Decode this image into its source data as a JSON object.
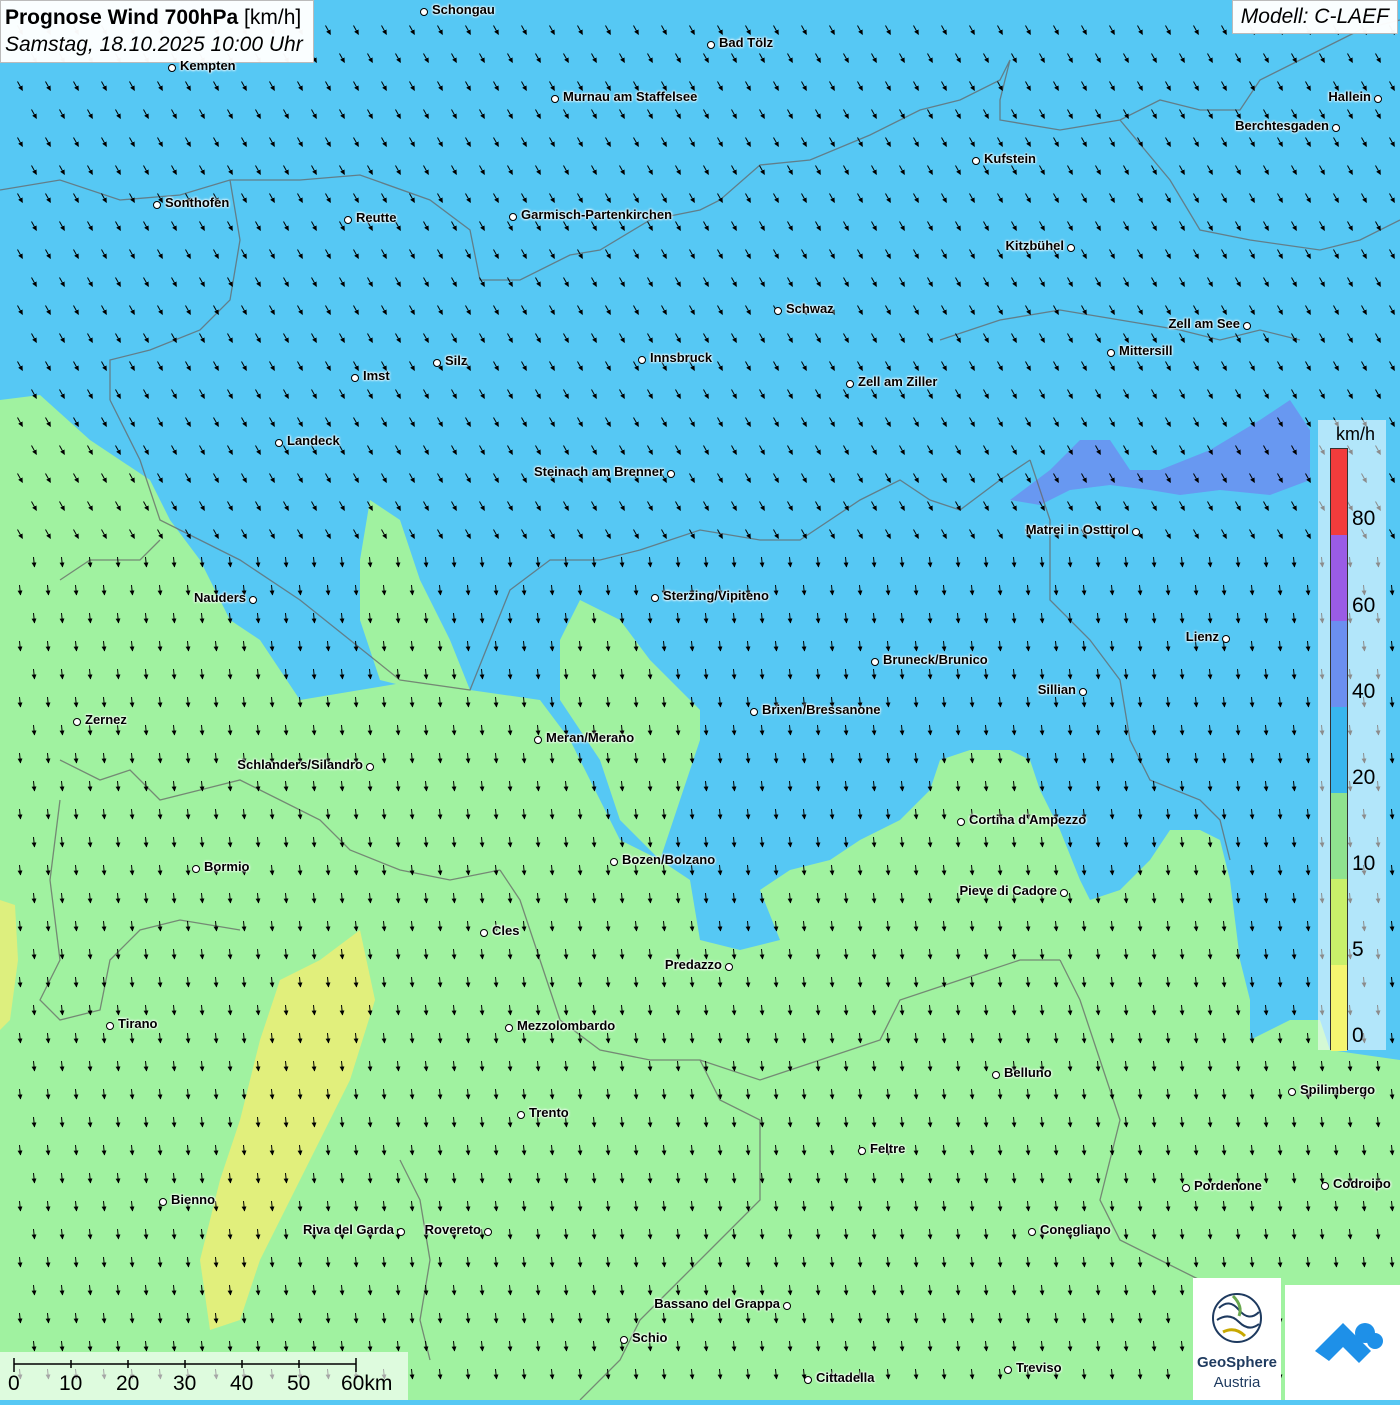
{
  "title": {
    "bold": "Prognose Wind 700hPa",
    "unit": "[km/h]",
    "datetime": "Samstag, 18.10.2025 10:00 Uhr"
  },
  "model": "Modell: C-LAEF",
  "legend": {
    "unit": "km/h",
    "labels": [
      "80",
      "60",
      "40",
      "20",
      "10",
      "5",
      "0"
    ],
    "colors": {
      "band_80_plus": "#f23c3c",
      "band_60_80": "#9a5ce6",
      "band_40_60": "#6b8ff0",
      "band_20_40": "#38b6ee",
      "band_10_20": "#8fe28f",
      "band_5_10": "#c8f06a",
      "band_0_5": "#f5f570"
    }
  },
  "scale_bar": {
    "labels": [
      "0",
      "10",
      "20",
      "30",
      "40",
      "50",
      "60km"
    ]
  },
  "field_colors": {
    "strong_wind": "#56c8f4",
    "moderate_wind": "#a0f2a0",
    "weak_wind": "#e8ee78",
    "high_wind": "#6b8ff0"
  },
  "wind_direction": "north-west",
  "cities": [
    {
      "name": "Schongau",
      "side": "right"
    },
    {
      "name": "Kempten",
      "side": "right"
    },
    {
      "name": "Bad Tölz",
      "side": "right"
    },
    {
      "name": "Murnau am Staffelsee",
      "side": "right"
    },
    {
      "name": "Hallein",
      "side": "left"
    },
    {
      "name": "Berchtesgaden",
      "side": "left"
    },
    {
      "name": "Kufstein",
      "side": "right"
    },
    {
      "name": "Sonthofen",
      "side": "right"
    },
    {
      "name": "Reutte",
      "side": "right"
    },
    {
      "name": "Garmisch-Partenkirchen",
      "side": "right"
    },
    {
      "name": "Kitzbühel",
      "side": "left"
    },
    {
      "name": "Schwaz",
      "side": "right"
    },
    {
      "name": "Zell am See",
      "side": "left"
    },
    {
      "name": "Innsbruck",
      "side": "right"
    },
    {
      "name": "Mittersill",
      "side": "right"
    },
    {
      "name": "Silz",
      "side": "right"
    },
    {
      "name": "Imst",
      "side": "right"
    },
    {
      "name": "Zell am Ziller",
      "side": "right"
    },
    {
      "name": "Landeck",
      "side": "right"
    },
    {
      "name": "Steinach am Brenner",
      "side": "left"
    },
    {
      "name": "Matrei in Osttirol",
      "side": "left"
    },
    {
      "name": "Nauders",
      "side": "left"
    },
    {
      "name": "Sterzing/Vipiteno",
      "side": "right"
    },
    {
      "name": "Lienz",
      "side": "left"
    },
    {
      "name": "Bruneck/Brunico",
      "side": "right"
    },
    {
      "name": "Sillian",
      "side": "left"
    },
    {
      "name": "Brixen/Bressanone",
      "side": "right"
    },
    {
      "name": "Zernez",
      "side": "right"
    },
    {
      "name": "Meran/Merano",
      "side": "right"
    },
    {
      "name": "Schlanders/Silandro",
      "side": "left"
    },
    {
      "name": "Cortina d'Ampezzo",
      "side": "right"
    },
    {
      "name": "Bozen/Bolzano",
      "side": "right"
    },
    {
      "name": "Bormio",
      "side": "right"
    },
    {
      "name": "Pieve di Cadore",
      "side": "left"
    },
    {
      "name": "Cles",
      "side": "right"
    },
    {
      "name": "Predazzo",
      "side": "left"
    },
    {
      "name": "Tirano",
      "side": "right"
    },
    {
      "name": "Mezzolombardo",
      "side": "right"
    },
    {
      "name": "Belluno",
      "side": "right"
    },
    {
      "name": "Spilimbergo",
      "side": "right"
    },
    {
      "name": "Trento",
      "side": "right"
    },
    {
      "name": "Feltre",
      "side": "right"
    },
    {
      "name": "Pordenone",
      "side": "right"
    },
    {
      "name": "Codroipo",
      "side": "right"
    },
    {
      "name": "Bienno",
      "side": "right"
    },
    {
      "name": "Riva del Garda",
      "side": "left"
    },
    {
      "name": "Rovereto",
      "side": "left"
    },
    {
      "name": "Conegliano",
      "side": "right"
    },
    {
      "name": "Bassano del Grappa",
      "side": "left"
    },
    {
      "name": "Schio",
      "side": "right"
    },
    {
      "name": "Treviso",
      "side": "right"
    },
    {
      "name": "Cittadella",
      "side": "right"
    }
  ],
  "logos": {
    "geosphere_line1": "GeoSphere",
    "geosphere_line2": "Austria"
  }
}
